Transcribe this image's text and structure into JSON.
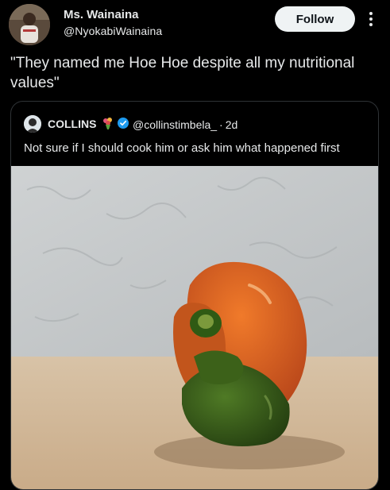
{
  "author": {
    "display_name": "Ms. Wainaina",
    "handle": "@NyokabiWainaina"
  },
  "follow_label": "Follow",
  "tweet": {
    "text": "\"They named me Hoe Hoe despite all my nutritional values\""
  },
  "quoted": {
    "display_name": "COLLINS",
    "handle": "@collinstimbela_",
    "time": "2d",
    "separator": "·",
    "text": "Not sure if I should cook him or ask him what happened first"
  },
  "colors": {
    "background": "#000000",
    "text": "#e7e9ea",
    "follow_bg": "#eff3f4",
    "follow_text": "#0f1419",
    "border": "#2f3336",
    "verified": "#1d9bf0"
  },
  "icons": {
    "more": "more-vertical-icon",
    "verified": "verified-badge-icon",
    "emoji": "bouquet-emoji-icon"
  },
  "media": {
    "subject": "bell pepper on a counter against a textured wall"
  }
}
